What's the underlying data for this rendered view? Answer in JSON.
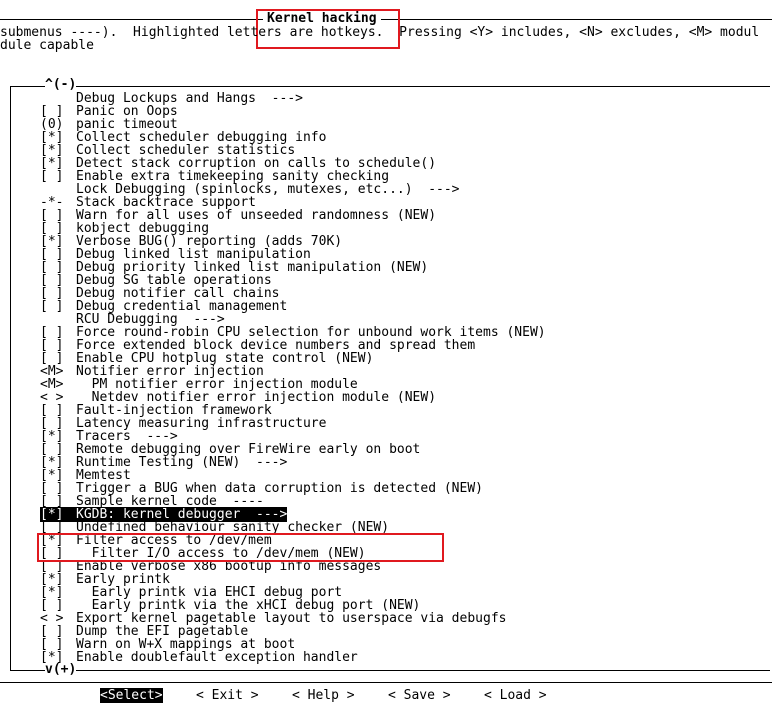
{
  "title": "Kernel hacking",
  "help_text": {
    "line1": "submenus ----).  Highlighted letters are hotkeys.  Pressing <Y> includes, <N> excludes, <M> modul",
    "line2": "dule capable"
  },
  "scroll_top": "^(-)",
  "scroll_bottom": "v(+)",
  "menu_items": [
    {
      "state": "",
      "label": "Debug Lockups and Hangs  --->"
    },
    {
      "state": "[ ]",
      "label": "Panic on Oops"
    },
    {
      "state": "(0)",
      "label": "panic timeout"
    },
    {
      "state": "[*]",
      "label": "Collect scheduler debugging info"
    },
    {
      "state": "[*]",
      "label": "Collect scheduler statistics"
    },
    {
      "state": "[*]",
      "label": "Detect stack corruption on calls to schedule()"
    },
    {
      "state": "[ ]",
      "label": "Enable extra timekeeping sanity checking"
    },
    {
      "state": "",
      "label": "Lock Debugging (spinlocks, mutexes, etc...)  --->"
    },
    {
      "state": "-*-",
      "label": "Stack backtrace support"
    },
    {
      "state": "[ ]",
      "label": "Warn for all uses of unseeded randomness (NEW)"
    },
    {
      "state": "[ ]",
      "label": "kobject debugging"
    },
    {
      "state": "[*]",
      "label": "Verbose BUG() reporting (adds 70K)"
    },
    {
      "state": "[ ]",
      "label": "Debug linked list manipulation"
    },
    {
      "state": "[ ]",
      "label": "Debug priority linked list manipulation (NEW)"
    },
    {
      "state": "[ ]",
      "label": "Debug SG table operations"
    },
    {
      "state": "[ ]",
      "label": "Debug notifier call chains"
    },
    {
      "state": "[ ]",
      "label": "Debug credential management"
    },
    {
      "state": "",
      "label": "RCU Debugging  --->"
    },
    {
      "state": "[ ]",
      "label": "Force round-robin CPU selection for unbound work items (NEW)"
    },
    {
      "state": "[ ]",
      "label": "Force extended block device numbers and spread them"
    },
    {
      "state": "[ ]",
      "label": "Enable CPU hotplug state control (NEW)"
    },
    {
      "state": "<M>",
      "label": "Notifier error injection"
    },
    {
      "state": "<M>",
      "label": "  PM notifier error injection module"
    },
    {
      "state": "< >",
      "label": "  Netdev notifier error injection module (NEW)"
    },
    {
      "state": "[ ]",
      "label": "Fault-injection framework"
    },
    {
      "state": "[ ]",
      "label": "Latency measuring infrastructure"
    },
    {
      "state": "[*]",
      "label": "Tracers  --->"
    },
    {
      "state": "[ ]",
      "label": "Remote debugging over FireWire early on boot"
    },
    {
      "state": "[*]",
      "label": "Runtime Testing (NEW)  --->"
    },
    {
      "state": "[*]",
      "label": "Memtest"
    },
    {
      "state": "[ ]",
      "label": "Trigger a BUG when data corruption is detected (NEW)"
    },
    {
      "state": "[ ]",
      "label": "Sample kernel code  ----"
    },
    {
      "state": "[*]",
      "label": "KGDB: kernel debugger  --->",
      "selected": true
    },
    {
      "state": "[ ]",
      "label": "Undefined behaviour sanity checker (NEW)"
    },
    {
      "state": "[*]",
      "label": "Filter access to /dev/mem"
    },
    {
      "state": "[ ]",
      "label": "  Filter I/O access to /dev/mem (NEW)"
    },
    {
      "state": "[ ]",
      "label": "Enable verbose x86 bootup info messages"
    },
    {
      "state": "[*]",
      "label": "Early printk"
    },
    {
      "state": "[*]",
      "label": "  Early printk via EHCI debug port"
    },
    {
      "state": "[ ]",
      "label": "  Early printk via the xHCI debug port (NEW)"
    },
    {
      "state": "< >",
      "label": "Export kernel pagetable layout to userspace via debugfs"
    },
    {
      "state": "[ ]",
      "label": "Dump the EFI pagetable"
    },
    {
      "state": "[ ]",
      "label": "Warn on W+X mappings at boot"
    },
    {
      "state": "[*]",
      "label": "Enable doublefault exception handler"
    }
  ],
  "buttons": [
    {
      "label": "<Select>",
      "selected": true
    },
    {
      "label": "< Exit >"
    },
    {
      "label": "< Help >"
    },
    {
      "label": "< Save >"
    },
    {
      "label": "< Load >"
    }
  ],
  "highlight_color": "#e0191f"
}
